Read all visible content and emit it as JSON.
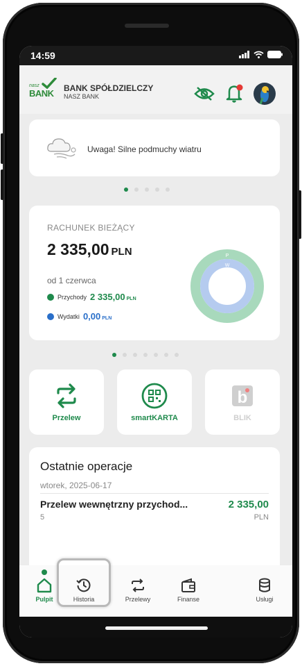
{
  "status_bar": {
    "time": "14:59"
  },
  "header": {
    "logo_small": "nasz",
    "logo_big": "BANK",
    "bank_name": "BANK SPÓŁDZIELCZY",
    "bank_sub": "NASZ BANK",
    "icons": [
      "eye-slash-icon",
      "bell-icon",
      "avatar"
    ]
  },
  "alert": {
    "text": "Uwaga! Silne podmuchy wiatru",
    "icon": "wind-cloud-icon"
  },
  "account": {
    "label": "RACHUNEK BIEŻĄCY",
    "amount": "2 335,00",
    "currency": "PLN",
    "since": "od 1 czerwca",
    "income_label": "Przychody",
    "income_value": "2 335,00",
    "income_currency": "PLN",
    "expense_label": "Wydatki",
    "expense_value": "0,00",
    "expense_currency": "PLN",
    "donut_p_label": "P",
    "donut_w_label": "W",
    "colors": {
      "income": "#1f8a4c",
      "expense": "#2a6fc9"
    }
  },
  "tiles": [
    {
      "label": "Przelew",
      "icon": "transfer-arrows-icon"
    },
    {
      "label": "smartKARTA",
      "icon": "qr-code-icon"
    },
    {
      "label": "BLIK",
      "icon": "blik-icon"
    }
  ],
  "operations": {
    "title": "Ostatnie operacje",
    "date": "wtorek, 2025-06-17",
    "desc": "Przelew wewnętrzny przychod...",
    "desc_extra": "5",
    "amount": "2 335,00",
    "currency": "PLN"
  },
  "nav": [
    {
      "label": "Pulpit",
      "icon": "home-icon"
    },
    {
      "label": "Historia",
      "icon": "history-icon"
    },
    {
      "label": "Przelewy",
      "icon": "transfer-arrows-icon"
    },
    {
      "label": "Finanse",
      "icon": "wallet-icon"
    },
    {
      "label": "Usługi",
      "icon": "database-icon"
    }
  ],
  "carousel_1": {
    "count": 5,
    "active": 0
  },
  "carousel_2": {
    "count": 7,
    "active": 0
  }
}
